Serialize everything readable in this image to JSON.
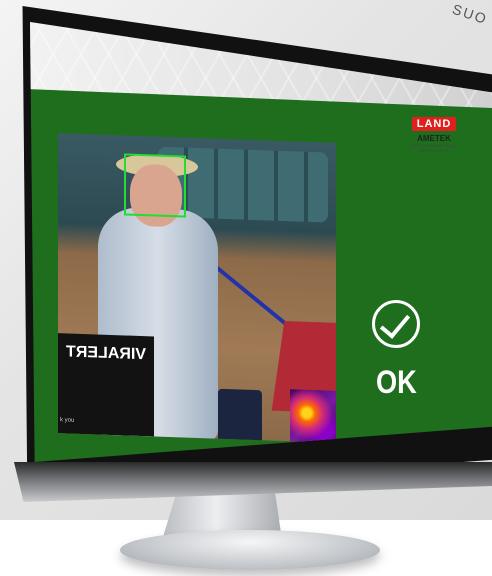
{
  "corner_text": "SUO",
  "logo": {
    "brand": "LAND",
    "company": "AMETEK",
    "tagline": "PROCESS & ANALYTICAL INSTRUMENTS"
  },
  "camera_feed": {
    "kiosk_label": "VIRALERT",
    "kiosk_small_text": "k you"
  },
  "status": {
    "text": "OK",
    "icon": "check-circle-icon"
  },
  "colors": {
    "screen_background": "#1e6e1e",
    "face_box": "#22dd33",
    "logo_red": "#e0201f"
  }
}
